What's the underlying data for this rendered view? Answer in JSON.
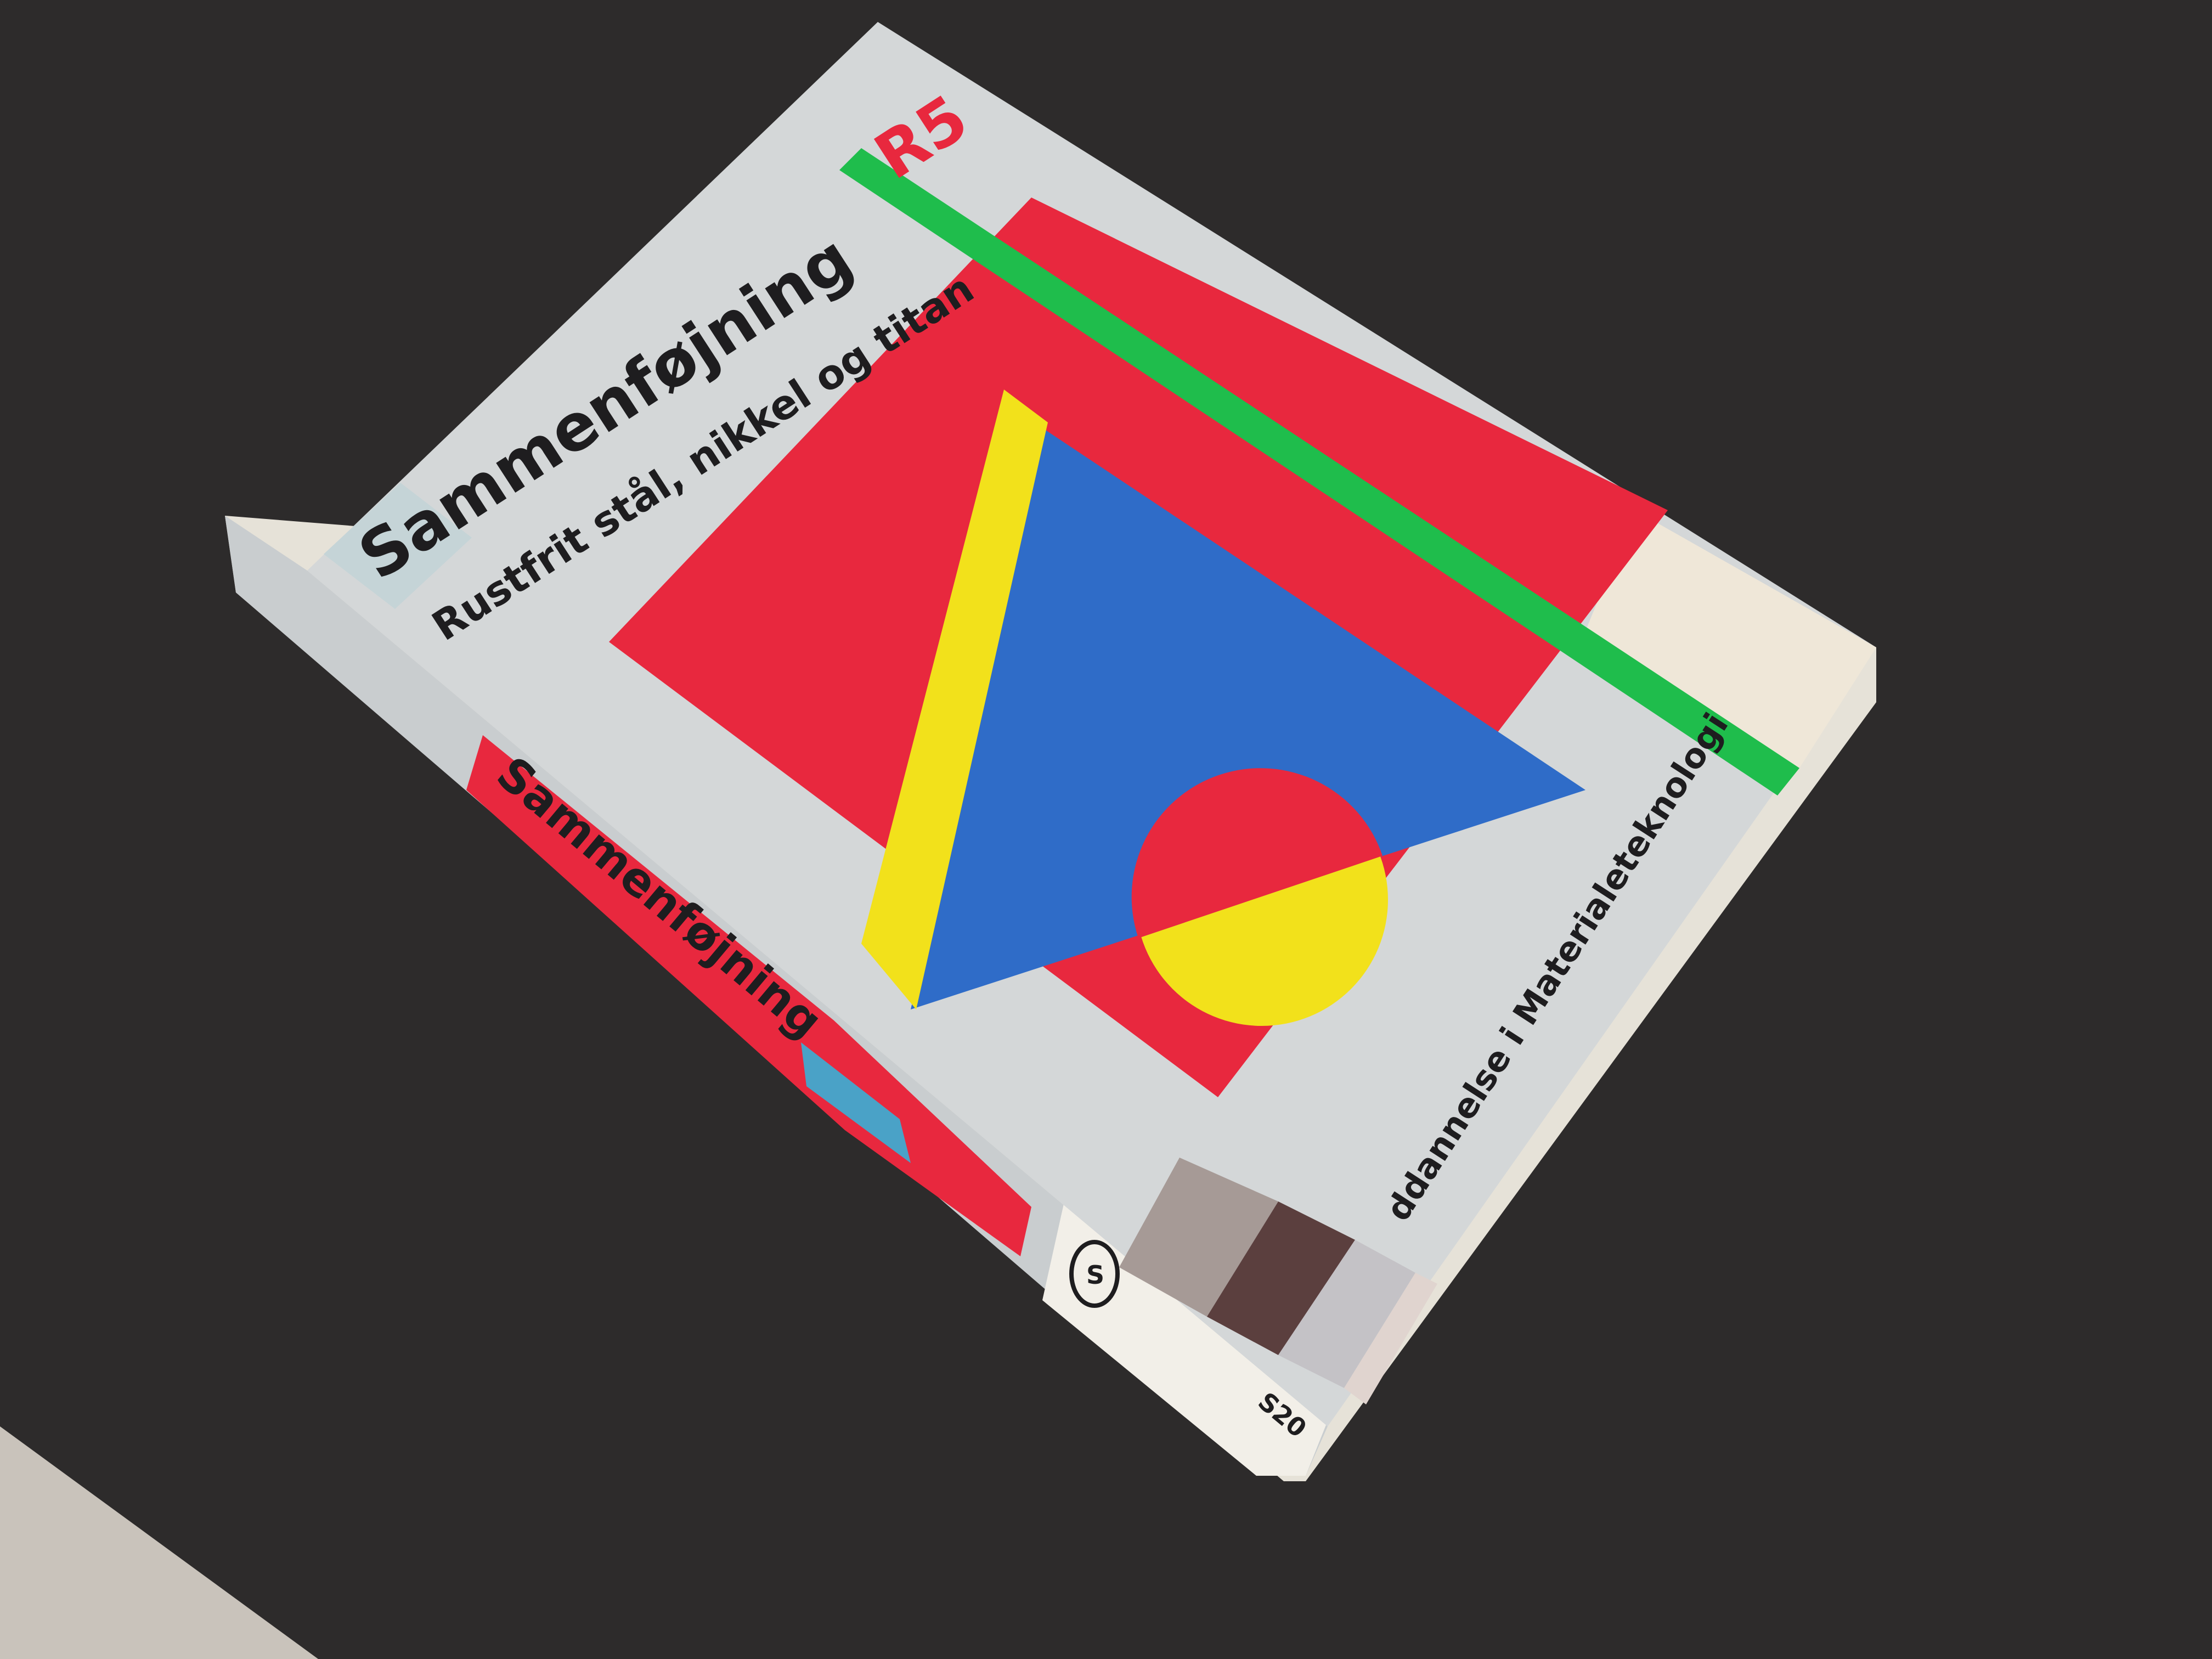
{
  "book": {
    "title": "Sammenføjning",
    "subtitle": "Rustfrit stål, nikkel og titan",
    "series_code": "R5",
    "series_name": "ddannelse i Materialeteknologi",
    "spine_title": "Sammenføjning",
    "library_mark": "S",
    "shelf_number": "S20"
  },
  "colors": {
    "table": "#2d2b2b",
    "floor": "#c9c3bb",
    "cover": "#d4d7d8",
    "red": "#e8283e",
    "blue": "#2f6cc8",
    "yellow": "#f2e11b",
    "green": "#1fbd4c",
    "cream": "#efe7d8"
  }
}
